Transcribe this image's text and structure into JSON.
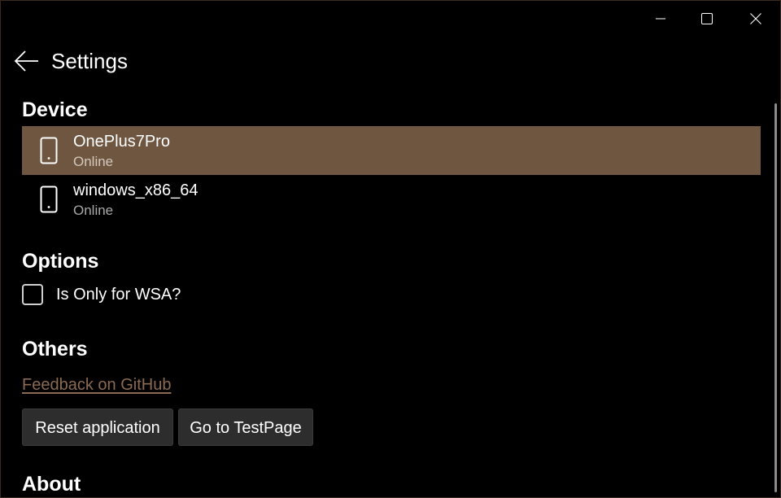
{
  "window": {
    "caption_icons": [
      "minimize-icon",
      "maximize-icon",
      "close-icon"
    ]
  },
  "header": {
    "back_icon": "back-arrow-icon",
    "title": "Settings"
  },
  "device_section": {
    "title": "Device",
    "devices": [
      {
        "name": "OnePlus7Pro",
        "status": "Online",
        "icon": "phone-icon",
        "selected": true
      },
      {
        "name": "windows_x86_64",
        "status": "Online",
        "icon": "phone-icon",
        "selected": false
      }
    ]
  },
  "options_section": {
    "title": "Options",
    "wsa_checkbox": {
      "label": "Is Only for WSA?",
      "checked": false
    }
  },
  "others_section": {
    "title": "Others",
    "feedback_link": "Feedback on GitHub",
    "reset_button": "Reset application",
    "testpage_button": "Go to TestPage"
  },
  "about_section": {
    "title": "About"
  },
  "colors": {
    "accent": "#6e5640",
    "link": "#8a6a52",
    "background": "#000000"
  }
}
